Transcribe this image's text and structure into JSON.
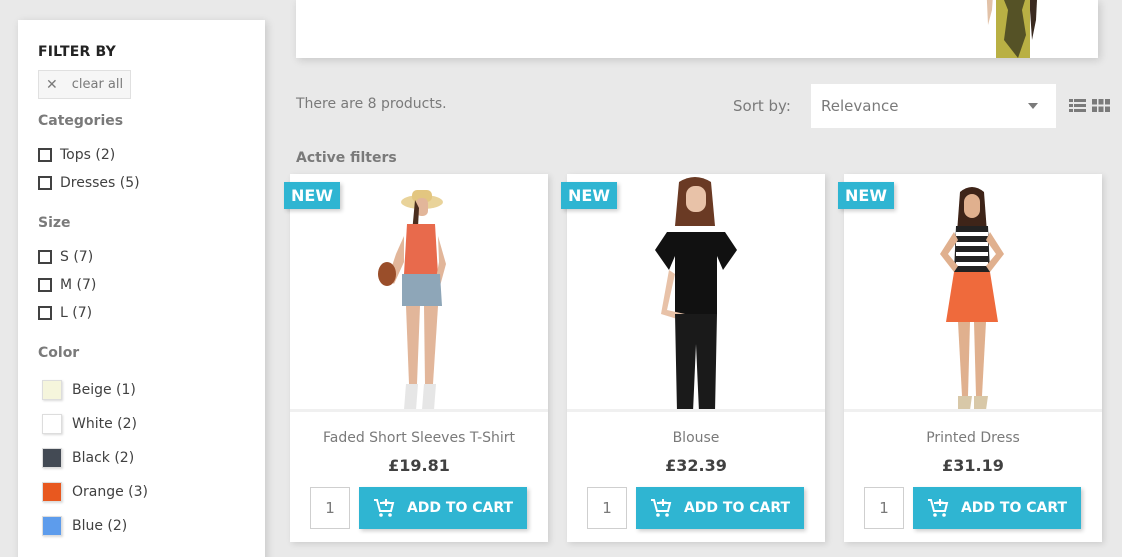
{
  "sidebar": {
    "title": "FILTER BY",
    "clear_all": "clear all",
    "categories": {
      "title": "Categories",
      "items": [
        {
          "label": "Tops (2)"
        },
        {
          "label": "Dresses (5)"
        }
      ]
    },
    "size": {
      "title": "Size",
      "items": [
        {
          "label": "S (7)"
        },
        {
          "label": "M (7)"
        },
        {
          "label": "L (7)"
        }
      ]
    },
    "color": {
      "title": "Color",
      "items": [
        {
          "label": "Beige (1)",
          "color": "#f5f5dc"
        },
        {
          "label": "White (2)",
          "color": "#ffffff"
        },
        {
          "label": "Black (2)",
          "color": "#434a54"
        },
        {
          "label": "Orange (3)",
          "color": "#e8581f"
        },
        {
          "label": "Blue (2)",
          "color": "#5d9cec"
        }
      ]
    }
  },
  "toolbar": {
    "product_count": "There are 8 products.",
    "sort_label": "Sort by:",
    "sort_value": "Relevance",
    "active_filters": "Active filters"
  },
  "products": [
    {
      "badge": "NEW",
      "name": "Faded Short Sleeves T-Shirt",
      "price": "£19.81",
      "qty": "1",
      "button": "ADD TO CART"
    },
    {
      "badge": "NEW",
      "name": "Blouse",
      "price": "£32.39",
      "qty": "1",
      "button": "ADD TO CART"
    },
    {
      "badge": "NEW",
      "name": "Printed Dress",
      "price": "£31.19",
      "qty": "1",
      "button": "ADD TO CART"
    }
  ],
  "colors": {
    "accent": "#2fb5d2"
  },
  "icons": [
    "close-icon",
    "chevron-down-icon",
    "list-view-icon",
    "grid-view-icon",
    "add-to-cart-icon"
  ]
}
